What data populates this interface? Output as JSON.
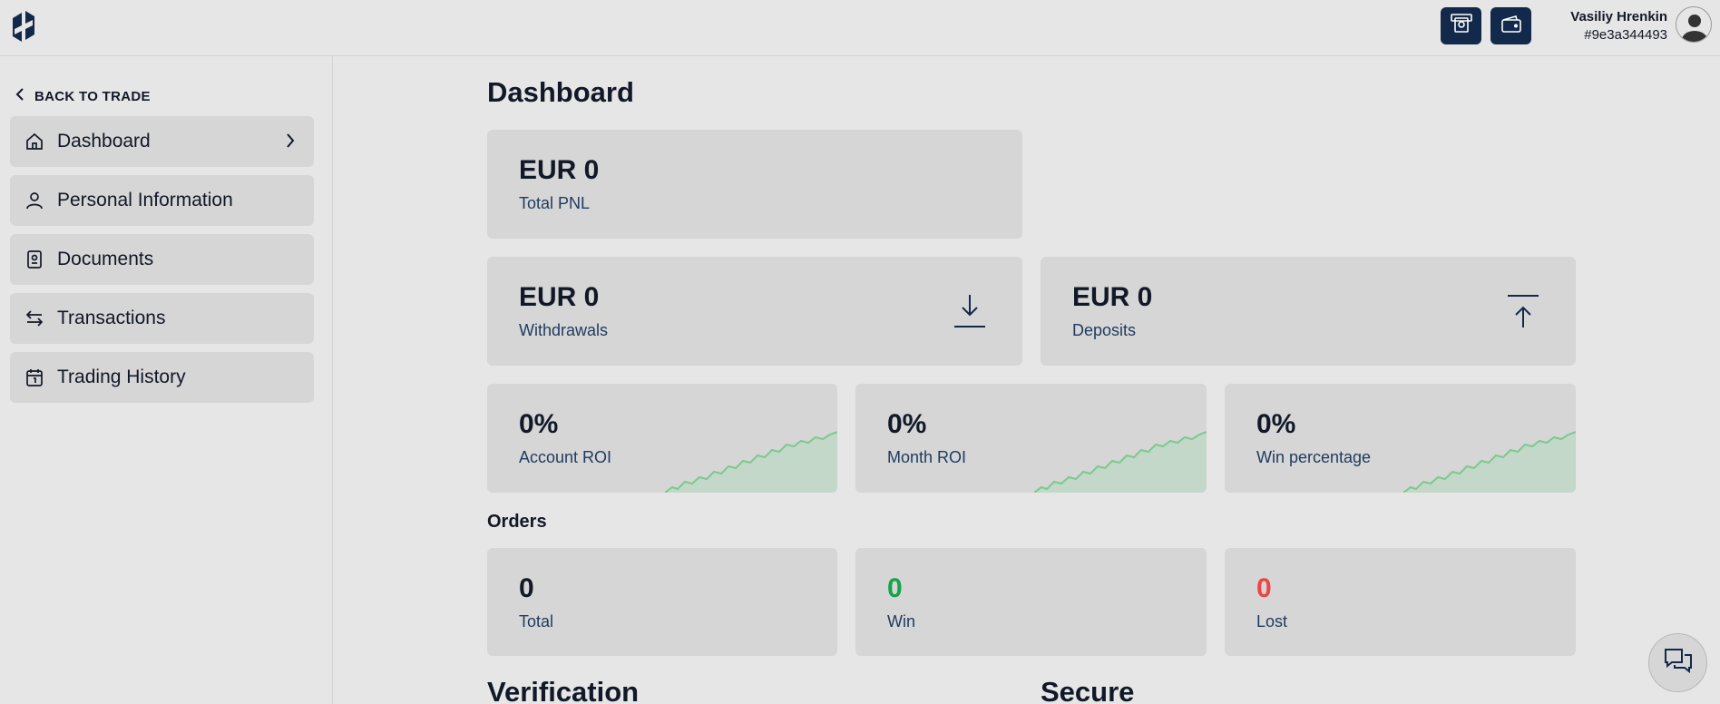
{
  "header": {
    "user_name": "Vasiliy Hrenkin",
    "user_id": "#9e3a344493",
    "icons": [
      "logo-icon",
      "atm-deposit-icon",
      "wallet-icon",
      "avatar-icon"
    ]
  },
  "sidebar": {
    "back_label": "BACK TO TRADE",
    "items": [
      {
        "label": "Dashboard",
        "icon": "home-icon"
      },
      {
        "label": "Personal Information",
        "icon": "user-icon"
      },
      {
        "label": "Documents",
        "icon": "document-icon"
      },
      {
        "label": "Transactions",
        "icon": "transfer-icon"
      },
      {
        "label": "Trading History",
        "icon": "calendar-icon"
      }
    ]
  },
  "main": {
    "title": "Dashboard",
    "total_pnl": {
      "value": "EUR 0",
      "label": "Total PNL"
    },
    "withdrawals": {
      "value": "EUR 0",
      "label": "Withdrawals"
    },
    "deposits": {
      "value": "EUR 0",
      "label": "Deposits"
    },
    "account_roi": {
      "value": "0%",
      "label": "Account ROI"
    },
    "month_roi": {
      "value": "0%",
      "label": "Month ROI"
    },
    "win_percentage": {
      "value": "0%",
      "label": "Win percentage"
    },
    "orders_heading": "Orders",
    "orders_total": {
      "value": "0",
      "label": "Total"
    },
    "orders_win": {
      "value": "0",
      "label": "Win"
    },
    "orders_lost": {
      "value": "0",
      "label": "Lost"
    },
    "verification_heading": "Verification",
    "secure_heading": "Secure"
  },
  "colors": {
    "accent": "#13294b",
    "win": "#16a34a",
    "lost": "#ef4444",
    "spark_line": "#7cc98f",
    "spark_fill": "#c3d8c8"
  }
}
